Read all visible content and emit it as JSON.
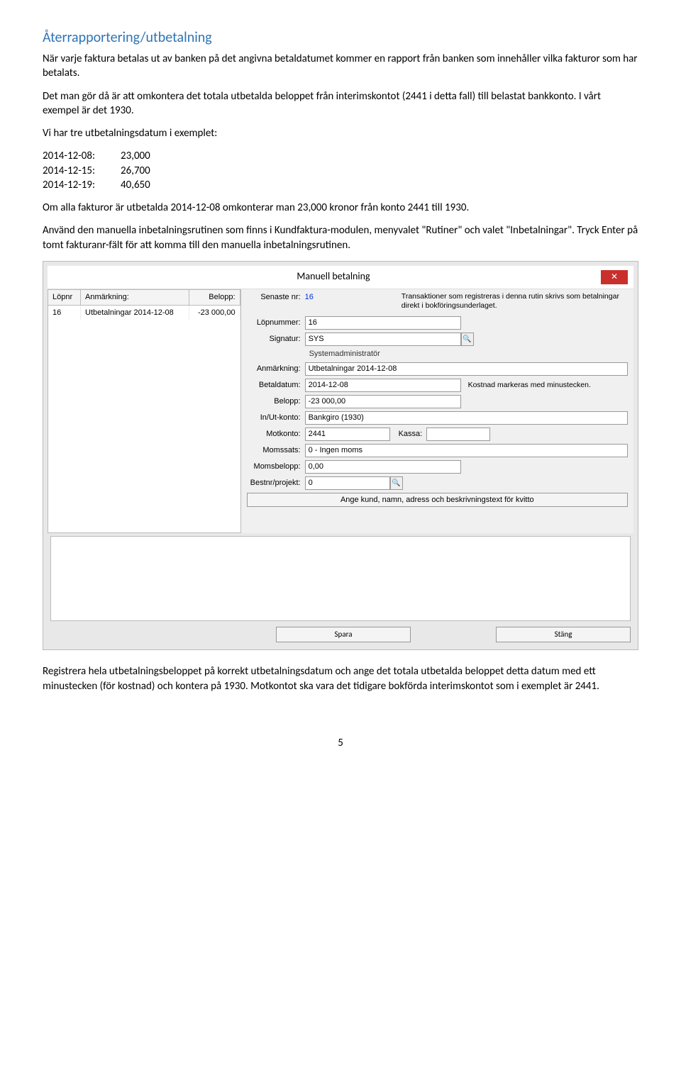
{
  "heading": "Återrapportering/utbetalning",
  "para1": "När varje faktura betalas ut av banken på det angivna betaldatumet kommer en rapport från banken som innehåller vilka fakturor som har betalats.",
  "para2": "Det man gör då är att omkontera det totala utbetalda beloppet från interimskontot (2441 i detta fall) till belastat bankkonto. I vårt exempel är det 1930.",
  "para3": "Vi har tre utbetalningsdatum i exemplet:",
  "dates": [
    {
      "d": "2014-12-08:",
      "v": "23,000"
    },
    {
      "d": "2014-12-15:",
      "v": "26,700"
    },
    {
      "d": "2014-12-19:",
      "v": "40,650"
    }
  ],
  "para4": "Om alla fakturor är utbetalda 2014-12-08 omkonterar man 23,000 kronor från konto 2441 till 1930.",
  "para5": "Använd den manuella inbetalningsrutinen som finns i Kundfaktura-modulen, menyvalet \"Rutiner\" och valet \"Inbetalningar\". Tryck Enter på tomt fakturanr-fält för att komma till den manuella inbetalningsrutinen.",
  "dlg": {
    "title": "Manuell betalning",
    "left": {
      "h1": "Löpnr",
      "h2": "Anmärkning:",
      "h3": "Belopp:",
      "r1c1": "16",
      "r1c2": "Utbetalningar 2014-12-08",
      "r1c3": "-23 000,00"
    },
    "info": "Transaktioner som registreras i denna rutin skrivs som betalningar direkt i bokföringsunderlaget.",
    "senaste_lbl": "Senaste nr:",
    "senaste_val": "16",
    "lopnr_lbl": "Löpnummer:",
    "lopnr_val": "16",
    "sign_lbl": "Signatur:",
    "sign_val": "SYS",
    "sign_sub": "Systemadministratör",
    "anm_lbl": "Anmärkning:",
    "anm_val": "Utbetalningar 2014-12-08",
    "bet_lbl": "Betaldatum:",
    "bet_val": "2014-12-08",
    "bel_lbl": "Belopp:",
    "bel_val": "-23 000,00",
    "bel_note": "Kostnad markeras med minustecken.",
    "iu_lbl": "In/Ut-konto:",
    "iu_val": "Bankgiro (1930)",
    "mot_lbl": "Motkonto:",
    "mot_val": "2441",
    "kassa_lbl": "Kassa:",
    "moms_lbl": "Momssats:",
    "moms_val": "0   - Ingen moms",
    "mb_lbl": "Momsbelopp:",
    "mb_val": "0,00",
    "bp_lbl": "Bestnr/projekt:",
    "bp_val": "0",
    "long_btn": "Ange kund, namn, adress och beskrivningstext för kvitto",
    "spara": "Spara",
    "stang": "Stäng"
  },
  "para6": "Registrera hela utbetalningsbeloppet på korrekt utbetalningsdatum och ange det totala utbetalda beloppet detta datum med ett minustecken (för kostnad) och kontera på 1930. Motkontot ska vara det tidigare bokförda interimskontot som i exemplet är 2441.",
  "pnum": "5"
}
